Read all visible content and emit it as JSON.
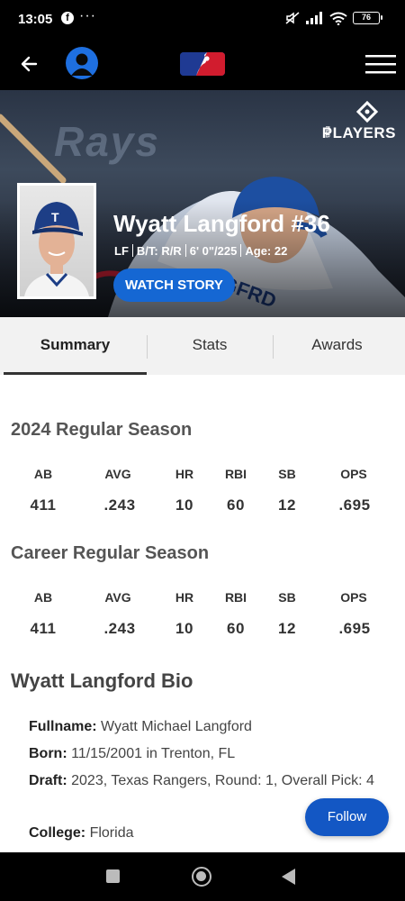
{
  "status_bar": {
    "time": "13:05",
    "dots": "···",
    "fb": "f",
    "battery": "76"
  },
  "header": {
    "back_icon": "arrow-left-icon",
    "avatar_icon": "user-icon",
    "logo_icon": "mlb-logo-icon",
    "menu_icon": "hamburger-menu-icon"
  },
  "hero": {
    "player_name": "Wyatt Langford #36",
    "position": "LF",
    "bats_throws": "B/T: R/R",
    "height_weight": "6' 0\"/225",
    "age": "Age: 22",
    "watch_label": "WATCH STORY",
    "badge_text": "PLAYERS",
    "badge_small": "MLB"
  },
  "tabs": [
    {
      "label": "Summary",
      "active": true
    },
    {
      "label": "Stats",
      "active": false
    },
    {
      "label": "Awards",
      "active": false
    }
  ],
  "stats_headers": [
    "AB",
    "AVG",
    "HR",
    "RBI",
    "SB",
    "OPS"
  ],
  "season": {
    "title": "2024 Regular Season",
    "values": [
      "411",
      ".243",
      "10",
      "60",
      "12",
      ".695"
    ]
  },
  "career": {
    "title": "Career Regular Season",
    "values": [
      "411",
      ".243",
      "10",
      "60",
      "12",
      ".695"
    ]
  },
  "bio": {
    "title": "Wyatt Langford Bio",
    "fullname_label": "Fullname:",
    "fullname": "Wyatt Michael Langford",
    "born_label": "Born:",
    "born": "11/15/2001 in Trenton, FL",
    "draft_label": "Draft:",
    "draft": "2023, Texas Rangers, Round: 1, Overall Pick: 4",
    "college_label": "College:",
    "college": "Florida"
  },
  "follow_label": "Follow",
  "colors": {
    "accent": "#1567d3",
    "follow": "#1357c4",
    "tab_bg": "#f2f2f2"
  }
}
